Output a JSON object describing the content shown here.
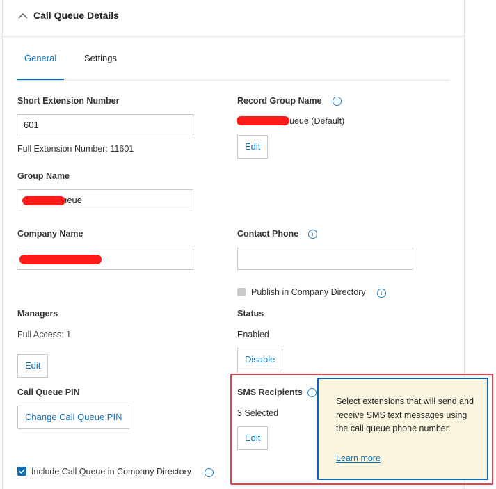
{
  "header": {
    "title": "Call Queue Details",
    "collapse_icon": "chevron-up-icon"
  },
  "tabs": [
    {
      "label": "General",
      "active": true
    },
    {
      "label": "Settings",
      "active": false
    }
  ],
  "short_extension": {
    "label": "Short Extension Number",
    "value": "601",
    "full_label": "Full Extension Number: 11601"
  },
  "record_group_name": {
    "label": "Record Group Name",
    "value_visible": "ueue (Default)",
    "edit_label": "Edit"
  },
  "group_name": {
    "label": "Group Name",
    "value_visible": "ueue"
  },
  "company_name": {
    "label": "Company Name"
  },
  "contact_phone": {
    "label": "Contact Phone",
    "value": ""
  },
  "publish_directory": {
    "label": "Publish in Company Directory",
    "checked": false
  },
  "managers": {
    "label": "Managers",
    "full_access": "Full Access: 1",
    "edit_label": "Edit"
  },
  "status": {
    "label": "Status",
    "value": "Enabled",
    "button_label": "Disable"
  },
  "pin": {
    "label": "Call Queue PIN",
    "button_label": "Change Call Queue PIN"
  },
  "sms": {
    "label": "SMS Recipients",
    "count": "3 Selected",
    "edit_label": "Edit"
  },
  "include_directory": {
    "label": "Include Call Queue in Company Directory",
    "checked": true
  },
  "tooltip": {
    "text": "Select extensions that will send and receive SMS text messages using the call queue phone number.",
    "link": "Learn more"
  },
  "colors": {
    "accent": "#0b6eb5",
    "highlight_border": "#e8414a",
    "tooltip_bg": "#fbf6e0",
    "redaction": "#ff1a1a"
  }
}
